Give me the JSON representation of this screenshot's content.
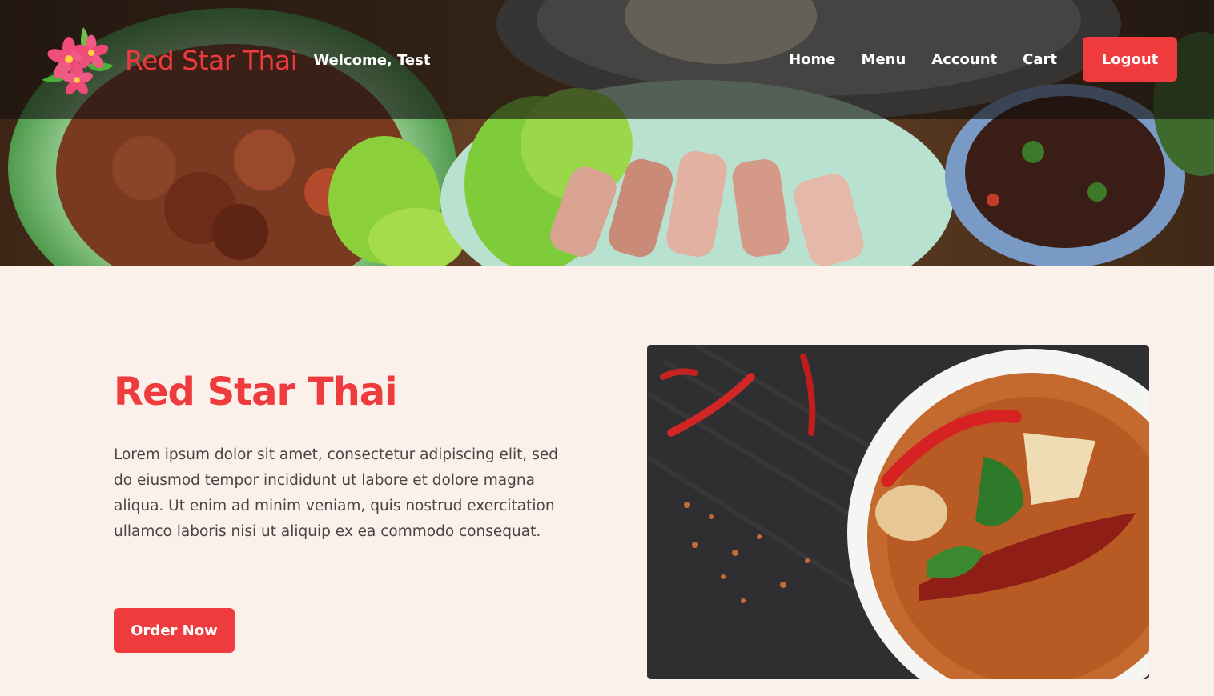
{
  "header": {
    "brand_name": "Red Star Thai",
    "welcome": "Welcome, Test",
    "nav": [
      "Home",
      "Menu",
      "Account",
      "Cart"
    ],
    "logout_label": "Logout"
  },
  "hero_image": {
    "icon": "thai-food-banner-photo"
  },
  "main": {
    "title": "Red Star Thai",
    "body": "Lorem ipsum dolor sit amet, consectetur adipiscing elit, sed do eiusmod tempor incididunt ut labore et dolore magna aliqua. Ut enim ad minim veniam, quis nostrud exercitation ullamco laboris nisi ut aliquip ex ea commodo consequat.",
    "cta_label": "Order Now",
    "image": "red-curry-photo"
  },
  "colors": {
    "accent": "#ef3b3d",
    "background": "#fcf1ea",
    "body_text": "#4a4545"
  }
}
